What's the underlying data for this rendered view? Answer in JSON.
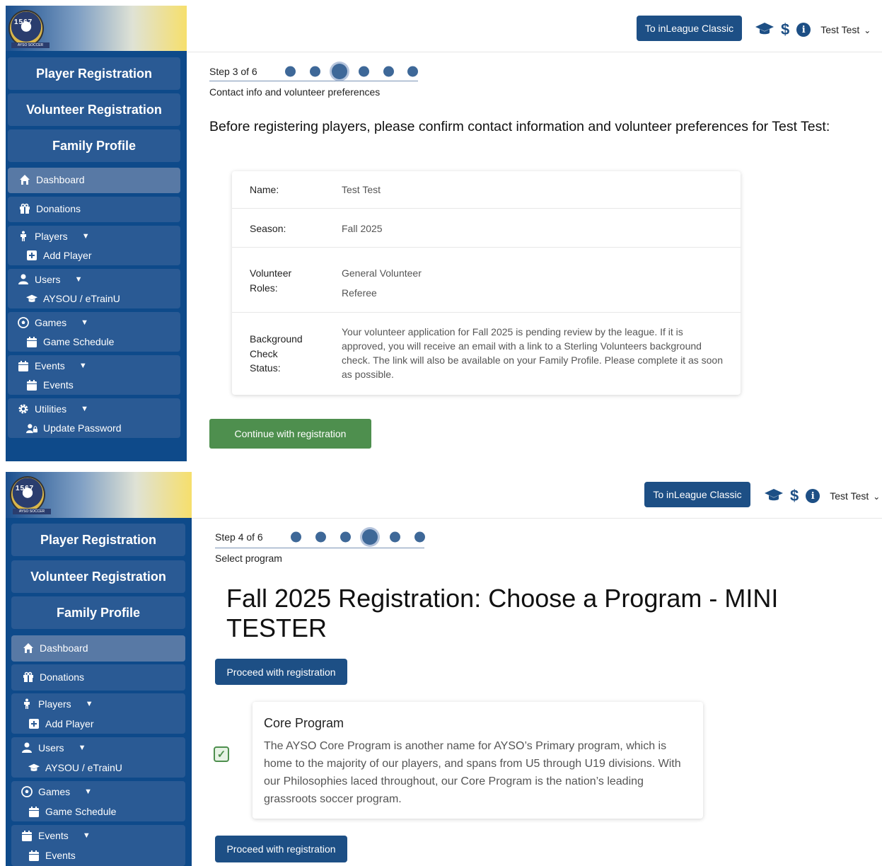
{
  "nav": {
    "player_registration": "Player Registration",
    "volunteer_registration": "Volunteer Registration",
    "family_profile": "Family Profile",
    "dashboard": "Dashboard",
    "donations": "Donations",
    "players": "Players",
    "add_player": "Add Player",
    "users": "Users",
    "aysou": "AYSOU / eTrainU",
    "games": "Games",
    "game_schedule": "Game Schedule",
    "events": "Events",
    "events_sub": "Events",
    "utilities": "Utilities",
    "update_password": "Update Password",
    "caret": "▼"
  },
  "logo": {
    "number": "1567",
    "subtitle": "AYSO SOCCER"
  },
  "header": {
    "classic_button": "To inLeague Classic",
    "user_name": "Test Test"
  },
  "screen1": {
    "step_label": "Step 3 of 6",
    "step_current": 3,
    "step_total": 6,
    "step_subtitle": "Contact info and volunteer preferences",
    "intro": "Before registering players, please confirm contact information and volunteer preferences for Test Test:",
    "rows": {
      "name_label": "Name:",
      "name_value": "Test Test",
      "season_label": "Season:",
      "season_value": "Fall 2025",
      "roles_label_1": "Volunteer",
      "roles_label_2": "Roles:",
      "role_1": "General Volunteer",
      "role_2": "Referee",
      "bg_label_1": "Background",
      "bg_label_2": "Check",
      "bg_label_3": "Status:",
      "bg_value": "Your volunteer application for Fall 2025 is pending review by the league. If it is approved, you will receive an email with a link to a Sterling Volunteers background check. The link will also be available on your Family Profile. Please complete it as soon as possible."
    },
    "continue_button": "Continue with registration"
  },
  "screen2": {
    "step_label": "Step 4 of 6",
    "step_current": 4,
    "step_total": 6,
    "step_subtitle": "Select program",
    "heading": "Fall 2025 Registration: Choose a Program - MINI TESTER",
    "proceed_button": "Proceed with registration",
    "program_title": "Core Program",
    "program_desc": "The AYSO Core Program is another name for AYSO’s Primary program, which is home to the majority of our players, and spans from U5 through U19 divisions. With our Philosophies laced throughout, our Core Program is the nation’s leading grassroots soccer program.",
    "program_checked": true
  },
  "colors": {
    "sidebar": "#0e4a8a",
    "nav_button": "#2a5a94",
    "primary": "#1d4f85",
    "success": "#4e8f4e"
  }
}
